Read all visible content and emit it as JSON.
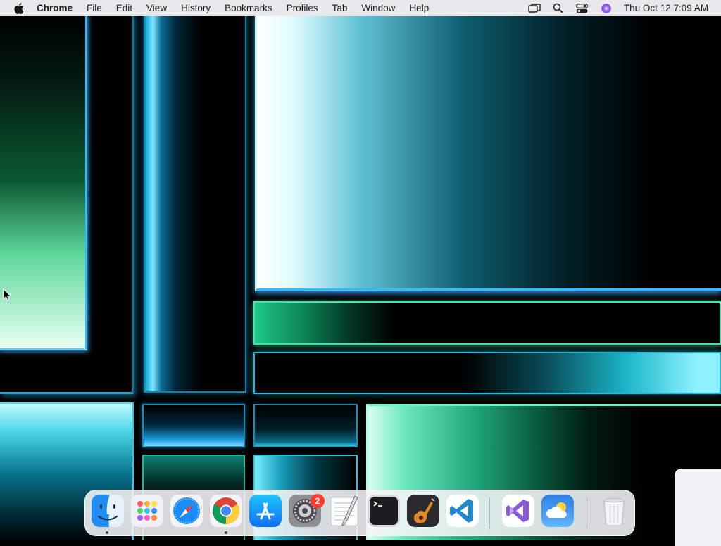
{
  "menubar": {
    "app_name": "Chrome",
    "menus": [
      "File",
      "Edit",
      "View",
      "History",
      "Bookmarks",
      "Profiles",
      "Tab",
      "Window",
      "Help"
    ],
    "clock": "Thu Oct 12  7:09 AM",
    "status_icons": [
      "screen-mirroring-icon",
      "search-icon",
      "control-center-icon",
      "siri-icon"
    ]
  },
  "dock": {
    "apps": [
      {
        "name": "Finder",
        "icon": "finder-icon",
        "running": true
      },
      {
        "name": "Launchpad",
        "icon": "launchpad-icon",
        "running": false
      },
      {
        "name": "Safari",
        "icon": "safari-icon",
        "running": false
      },
      {
        "name": "Google Chrome",
        "icon": "chrome-icon",
        "running": true
      },
      {
        "name": "App Store",
        "icon": "app-store-icon",
        "running": false
      },
      {
        "name": "System Settings",
        "icon": "system-settings-icon",
        "running": false,
        "badge": "2"
      },
      {
        "name": "TextEdit",
        "icon": "textedit-icon",
        "running": false
      },
      {
        "name": "Terminal",
        "icon": "terminal-icon",
        "running": false
      },
      {
        "name": "GarageBand",
        "icon": "garageband-icon",
        "running": false
      },
      {
        "name": "Visual Studio Code",
        "icon": "vscode-icon",
        "running": false
      },
      {
        "name": "Visual Studio",
        "icon": "visual-studio-icon",
        "running": false
      },
      {
        "name": "Weather",
        "icon": "weather-icon",
        "running": false
      },
      {
        "name": "Trash",
        "icon": "trash-icon",
        "running": false
      }
    ]
  },
  "colors": {
    "menubar_bg": "#e9e9ec",
    "badge": "#ff3b30",
    "wallpaper_accent_cyan": "#3ab8ff",
    "wallpaper_accent_green": "#43e6a8"
  }
}
